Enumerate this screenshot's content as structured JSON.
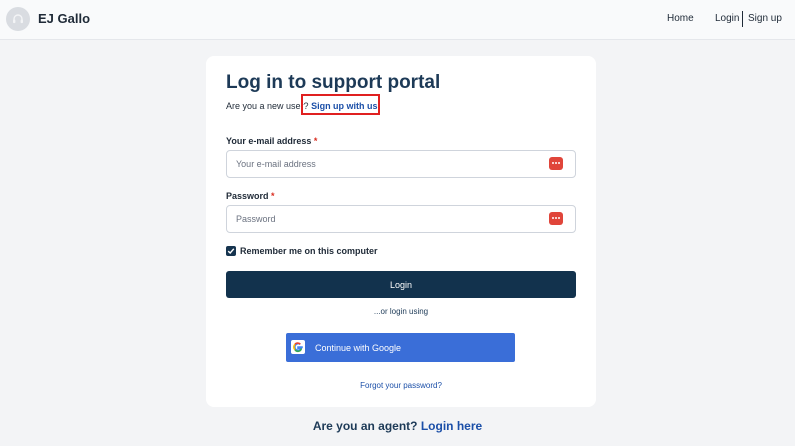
{
  "header": {
    "brand": "EJ Gallo",
    "nav": {
      "home": "Home",
      "login": "Login",
      "signup": "Sign up"
    }
  },
  "login_card": {
    "title": "Log in to support portal",
    "new_user_prompt": "Are you a new user?",
    "signup_link": "Sign up with us",
    "email": {
      "label": "Your e-mail address",
      "required_mark": "*",
      "placeholder": "Your e-mail address",
      "value": ""
    },
    "password": {
      "label": "Password",
      "required_mark": "*",
      "placeholder": "Password",
      "value": ""
    },
    "remember_me": {
      "label": "Remember me on this computer",
      "checked": true
    },
    "login_button": "Login",
    "or_login_using": "...or login using",
    "google_button": "Continue with Google",
    "forgot_password": "Forgot your password?"
  },
  "agent_prompt": {
    "text": "Are you an agent?",
    "link": "Login here"
  },
  "colors": {
    "primary_dark": "#12324d",
    "link_blue": "#1b4fa8",
    "google_blue": "#3a6ed8",
    "highlight_red": "#e02020",
    "required_red": "#d92d20"
  },
  "icons": {
    "logo": "headset-icon",
    "password_manager": "password-manager-icon",
    "checkbox": "checkmark-icon",
    "google": "google-g-icon"
  }
}
